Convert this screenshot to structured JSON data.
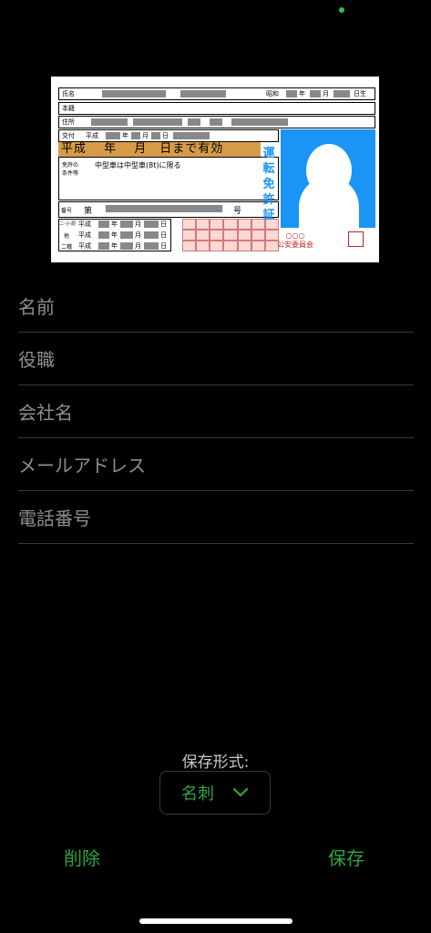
{
  "card": {
    "name_label": "氏名",
    "birth_label": "昭和",
    "year_char": "年",
    "month_char": "月",
    "day_char": "日生",
    "honseki_label": "本籍",
    "address_label": "住所",
    "issue_label": "交付",
    "issue_era": "平成",
    "issue_year": "年",
    "issue_month": "月",
    "issue_day": "日",
    "expiry_text": "平成　 年　 月　日まで有効",
    "conditions_label": "免許の\n条件等",
    "conditions_value": "中型車は中型車(8t)に限る",
    "number_label": "番号",
    "number_prefix": "第",
    "number_suffix": "号",
    "row1_label": "二·小·原",
    "row2_label": "他",
    "row3_label": "二種",
    "row_era": "平成",
    "row_y": "年",
    "row_m": "月",
    "row_d": "日",
    "vertical_title": "運転免許証",
    "seal_circles": "○○○",
    "commission": "公安委員会"
  },
  "fields": {
    "name": "名前",
    "title": "役職",
    "company": "会社名",
    "email": "メールアドレス",
    "phone": "電話番号"
  },
  "save_format": {
    "label": "保存形式:",
    "selected": "名刺"
  },
  "actions": {
    "delete": "削除",
    "save": "保存"
  },
  "colors": {
    "accent": "#2ba640",
    "photo_bg": "#1a94f5",
    "expiry_band": "#d79b47"
  }
}
